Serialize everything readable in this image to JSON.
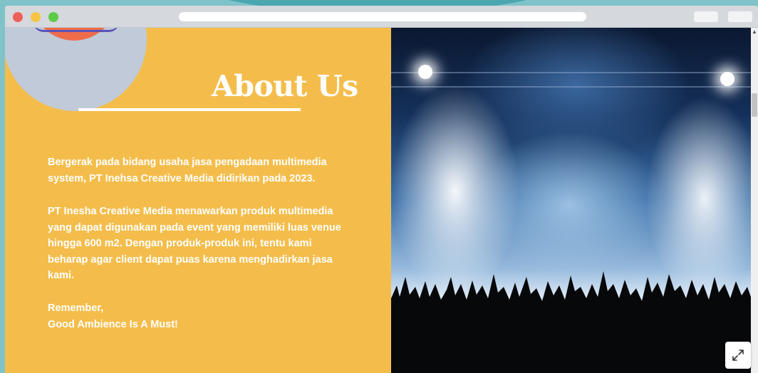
{
  "about": {
    "title": "About Us",
    "paragraph1": [
      "Bergerak pada bidang usaha jasa pengadaan multimedia",
      "system, PT Inehsa Creative Media didirikan pada 2023."
    ],
    "paragraph2": [
      "PT Inesha Creative Media menawarkan produk multimedia",
      "yang dapat digunakan pada event yang memiliki luas venue",
      "hingga 600 m2. Dengan produk-produk ini, tentu kami",
      "beharap agar client dapat puas karena menghadirkan jasa",
      "kami."
    ],
    "closing": [
      "Remember,",
      "Good Ambience Is A Must!"
    ]
  },
  "icons": {
    "expand": "expand-icon",
    "scroll_up": "chevron-up-icon"
  },
  "colors": {
    "panel_background": "#f4bd4b",
    "text": "#ffffff",
    "accent_circle": "#c0cad8",
    "accent_red": "#ef6c4b"
  }
}
